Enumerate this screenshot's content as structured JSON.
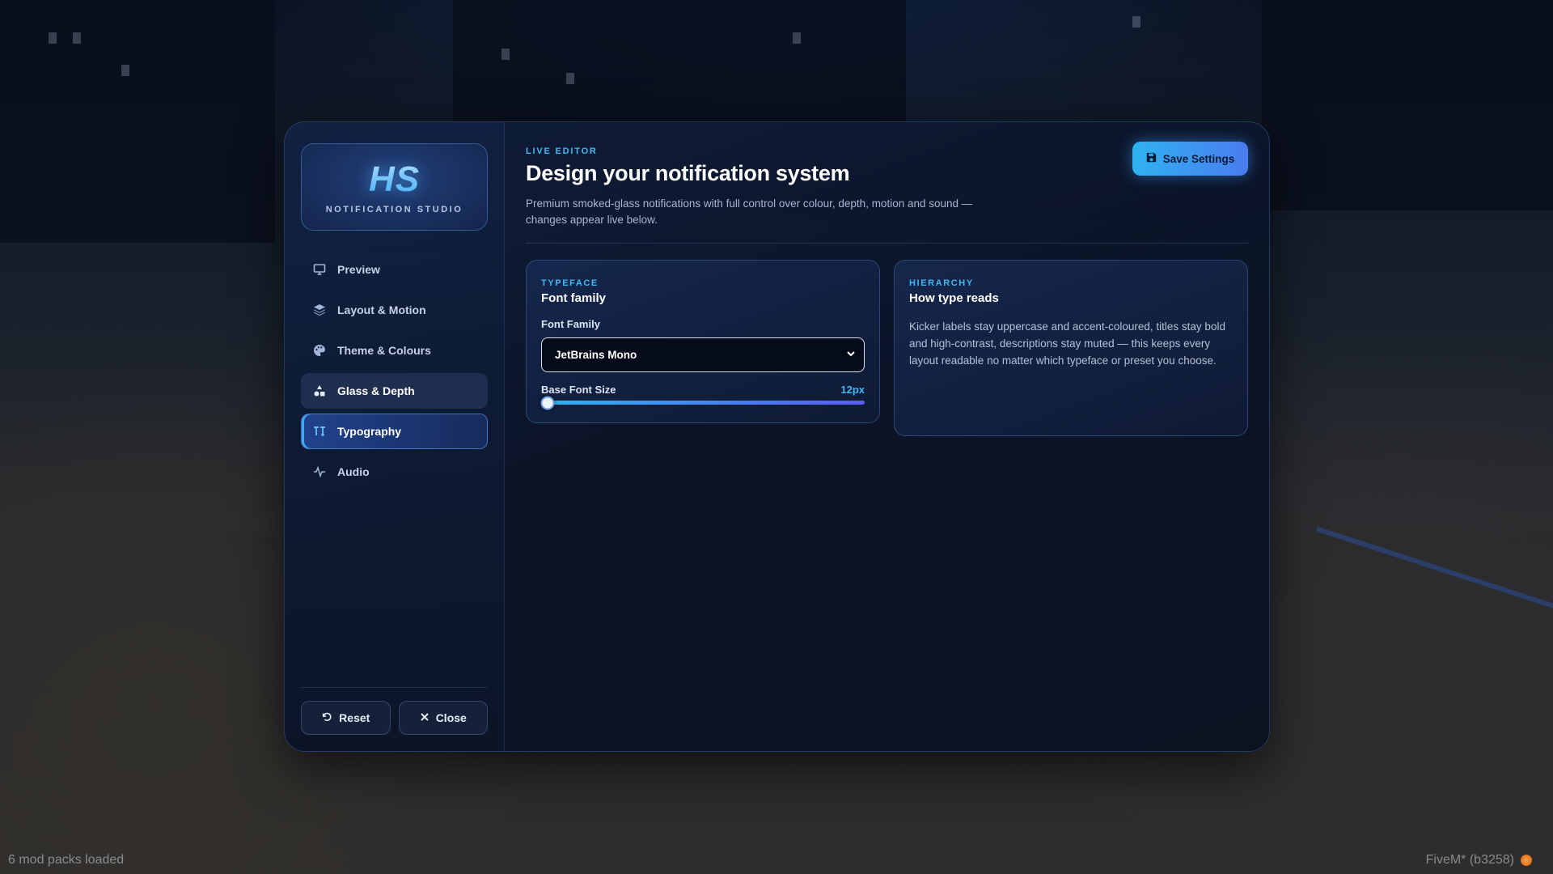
{
  "brand": {
    "logo_mark": "HS",
    "logo_subtitle": "NOTIFICATION STUDIO"
  },
  "sidebar": {
    "items": [
      {
        "label": "Preview",
        "icon": "monitor-icon",
        "state": "default"
      },
      {
        "label": "Layout & Motion",
        "icon": "layers-icon",
        "state": "default"
      },
      {
        "label": "Theme & Colours",
        "icon": "palette-icon",
        "state": "default"
      },
      {
        "label": "Glass & Depth",
        "icon": "shapes-icon",
        "state": "hover"
      },
      {
        "label": "Typography",
        "icon": "typography-icon",
        "state": "active"
      },
      {
        "label": "Audio",
        "icon": "waveform-icon",
        "state": "default"
      }
    ],
    "reset_label": "Reset",
    "close_label": "Close"
  },
  "header": {
    "kicker": "LIVE EDITOR",
    "title": "Design your notification system",
    "description": "Premium smoked-glass notifications with full control over colour, depth, motion and sound — changes appear live below.",
    "save_label": "Save Settings"
  },
  "typeface_card": {
    "kicker": "TYPEFACE",
    "title": "Font family",
    "font_family_label": "Font Family",
    "font_family_value": "JetBrains Mono",
    "base_font_size_label": "Base Font Size",
    "base_font_size_value": "12px",
    "base_font_size_fraction": 0.02
  },
  "hierarchy_card": {
    "kicker": "HIERARCHY",
    "title": "How type reads",
    "body": "Kicker labels stay uppercase and accent-coloured, titles stay bold and high-contrast, descriptions stay muted — this keeps every layout readable no matter which typeface or preset you choose."
  },
  "status_bar": {
    "left": "6 mod packs loaded",
    "right": "FiveM* (b3258)"
  },
  "colors": {
    "accent": "#3fb8f5",
    "accent_gradient_end": "#4a7cf0",
    "panel_bg": "#0b1428"
  }
}
